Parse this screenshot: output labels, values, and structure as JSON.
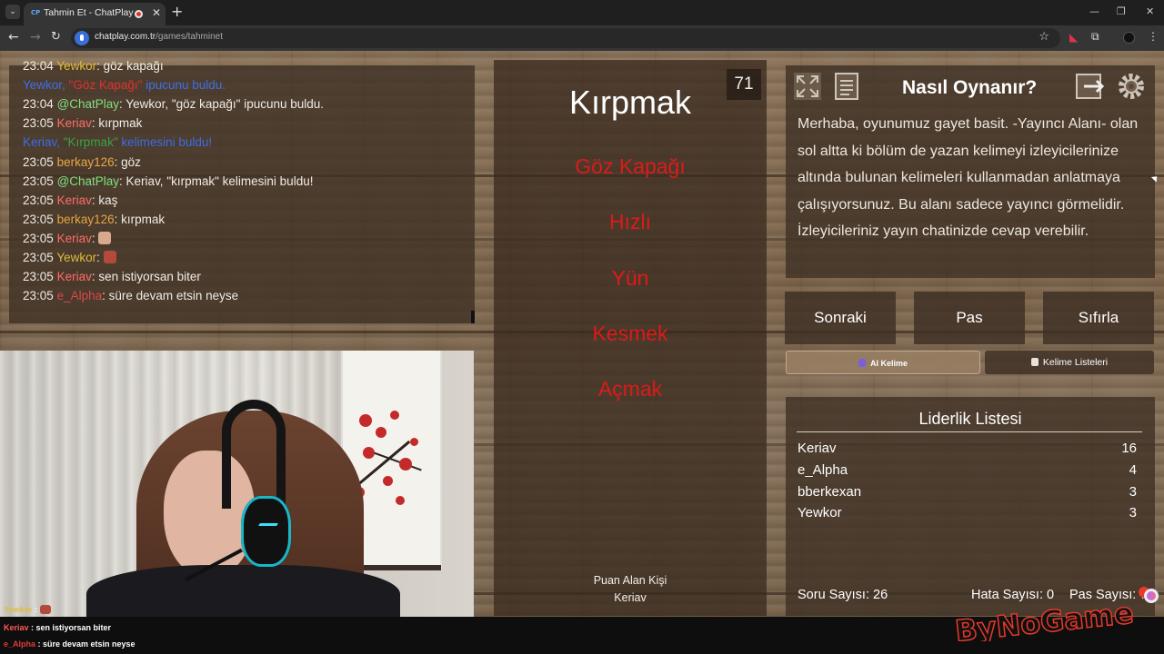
{
  "browser": {
    "tab_title": "Tahmin Et - ChatPlay",
    "tab_favicon": "CP",
    "url_domain": "chatplay.com.tr",
    "url_path": "/games/tahminet"
  },
  "chat": {
    "lines": [
      {
        "time": "23:04",
        "user": "Yewkor",
        "text": ": göz kapağı"
      },
      {
        "system": true,
        "user": "Yewkor, ",
        "word": "\"Göz Kapağı\"",
        "text": " ipucunu buldu."
      },
      {
        "time": "23:04",
        "user": "@ChatPlay",
        "text": ": Yewkor, \"göz kapağı\" ipucunu buldu."
      },
      {
        "time": "23:05",
        "user": "Keriav",
        "text": ": kırpmak"
      },
      {
        "system": true,
        "user": "Keriav, ",
        "word": "\"Kırpmak\"",
        "text": " kelimesini buldu!"
      },
      {
        "time": "23:05",
        "user": "berkay126",
        "text": ": göz"
      },
      {
        "time": "23:05",
        "user": "@ChatPlay",
        "text": ": Keriav, \"kırpmak\" kelimesini buldu!"
      },
      {
        "time": "23:05",
        "user": "Keriav",
        "text": ": kaş"
      },
      {
        "time": "23:05",
        "user": "berkay126",
        "text": ": kırpmak"
      },
      {
        "time": "23:05",
        "user": "Keriav",
        "text": ":"
      },
      {
        "time": "23:05",
        "user": "Yewkor",
        "text": ":"
      },
      {
        "time": "23:05",
        "user": "Keriav",
        "text": ": sen istiyorsan biter"
      },
      {
        "time": "23:05",
        "user": "e_Alpha",
        "text": ": süre devam etsin neyse"
      }
    ]
  },
  "cam_overlay": {
    "lines": [
      {
        "user": "Yewkor",
        "text": " :"
      },
      {
        "user": "Keriav",
        "text": " : sen istiyorsan biter"
      },
      {
        "user": "e_Alpha",
        "text": " : süre devam etsin neyse"
      }
    ]
  },
  "game": {
    "timer": "71",
    "word": "Kırpmak",
    "taboo_words": [
      "Göz Kapağı",
      "Hızlı",
      "Yün",
      "Kesmek",
      "Açmak"
    ],
    "scorer_label": "Puan Alan Kişi",
    "scorer_name": "Keriav"
  },
  "howto": {
    "title": "Nasıl Oynanır?",
    "text": "Merhaba, oyunumuz gayet basit. -Yayıncı Alanı- olan sol altta ki bölüm de yazan kelimeyi izleyicilerinize altında bulunan kelimeleri kullanmadan anlatmaya çalışıyorsunuz. Bu alanı sadece yayıncı görmelidir. İzleyicileriniz yayın chatinizde cevap verebilir."
  },
  "controls": {
    "next": "Sonraki",
    "pass": "Pas",
    "reset": "Sıfırla",
    "ai_word": "AI Kelime",
    "word_lists": "Kelime Listeleri"
  },
  "leaderboard": {
    "title": "Liderlik Listesi",
    "rows": [
      {
        "name": "Keriav",
        "score": "16"
      },
      {
        "name": "e_Alpha",
        "score": "4"
      },
      {
        "name": "bberkexan",
        "score": "3"
      },
      {
        "name": "Yewkor",
        "score": "3"
      }
    ]
  },
  "stats": {
    "questions": "Soru Sayısı: 26",
    "errors": "Hata Sayısı: 0",
    "passes": "Pas Sayısı: 7"
  },
  "brand": {
    "text": "ByNoGame"
  },
  "colors": {
    "wood": "#7b6349",
    "panel": "#3e3024",
    "taboo_red": "#dd1a1a",
    "system_blue": "#3c6ee6"
  }
}
